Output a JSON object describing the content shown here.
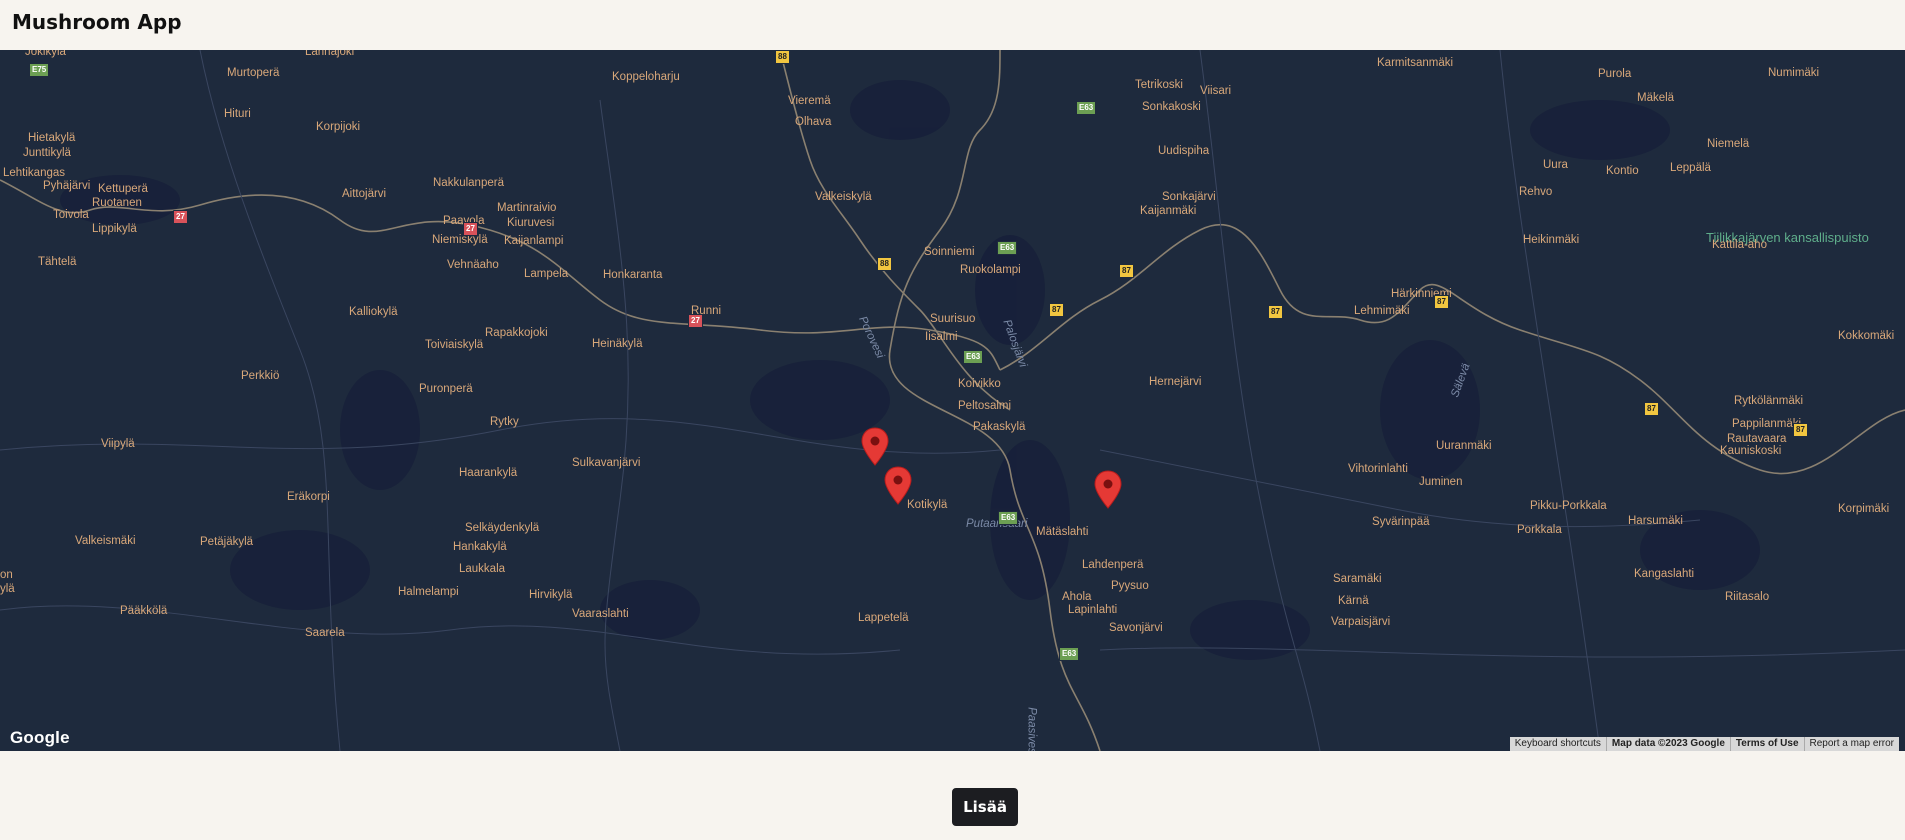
{
  "app": {
    "title": "Mushroom App"
  },
  "map": {
    "provider_logo": "Google",
    "attribution": {
      "keyboard_shortcuts": "Keyboard shortcuts",
      "map_data": "Map data ©2023 Google",
      "terms": "Terms of Use",
      "report": "Report a map error"
    },
    "marker_icon": "map-pin-icon",
    "marker_color": "#e53935",
    "marker_count": 3,
    "labels": [
      "Jokikylä",
      "Lahnajoki",
      "Murtoperä",
      "Koppeloharju",
      "Vieremä",
      "Olhava",
      "Karmitsanmäki",
      "Tetrikoski",
      "Viisari",
      "Sonkakoski",
      "Purola",
      "Numimäki",
      "Mäkelä",
      "Hituri",
      "Korpijoki",
      "Hietakylä",
      "Junttikylä",
      "Uudispiha",
      "Niemelä",
      "Lehtikangas",
      "Pyhäjärvi",
      "Kettuperä",
      "Aittojärvi",
      "Nakkulanperä",
      "Uura",
      "Kontio",
      "Leppälä",
      "Ruotanen",
      "Toivola",
      "Martinraivio",
      "Kiuruvesi",
      "Paavola",
      "Valkeiskylä",
      "Sonkajärvi",
      "Kaijanmäki",
      "Rehvo",
      "Tiilikkajärven kansallispuisto",
      "Lippikylä",
      "Niemiskylä",
      "Kaijanlampi",
      "Heikinmäki",
      "Kattila-aho",
      "Tähtelä",
      "Vehnäaho",
      "Soinniemi",
      "Lampela",
      "Honkaranta",
      "Ruokolampi",
      "Härkinniemi",
      "Runni",
      "Lehmimäki",
      "Kalliokylä",
      "Suurisuo",
      "Rapakkojoki",
      "Iisalmi",
      "Kokkomäki",
      "Toiviaiskylä",
      "Heinäkylä",
      "Perkkiö",
      "Koivikko",
      "Hernejärvi",
      "Puronperä",
      "Peltosalmi",
      "Rytkölänmäki",
      "Rytky",
      "Pakaskylä",
      "Pappilanmäki",
      "Rautavaara",
      "Kauniskoski",
      "Viipylä",
      "Uuranmäki",
      "Sulkavanjärvi",
      "Haarankylä",
      "Vihtorinlahti",
      "Juminen",
      "Eräkorpi",
      "Kotikylä",
      "Pikku-Porkkala",
      "Korpimäki",
      "Syvärinpää",
      "Harsumäki",
      "Selkäydenkylä",
      "Porkkala",
      "Valkeismäki",
      "Petäjäkylä",
      "Hankakylä",
      "Mätäslahti",
      "Laukkala",
      "Lahdenperä",
      "Kangaslahti",
      "Pyysuo",
      "Saramäki",
      "Halmelampi",
      "Hirvikylä",
      "Ahola",
      "Riitasalo",
      "Kärnä",
      "Pääkkölä",
      "Vaaraslahti",
      "Lappetelä",
      "Lapinlahti",
      "Varpaisjärvi",
      "Saarela",
      "Savonjärvi",
      "on",
      "ylä"
    ],
    "water_labels": [
      "Porovesi",
      "Palosjärvi",
      "Sälevä",
      "Putaansaari",
      "Paasivesi"
    ],
    "road_shields": [
      "88",
      "E75",
      "E63",
      "27",
      "88",
      "E63",
      "87",
      "27",
      "27",
      "E63",
      "87",
      "87",
      "87",
      "87",
      "87",
      "E63",
      "E63"
    ]
  },
  "footer": {
    "add_button": "Lisää"
  }
}
